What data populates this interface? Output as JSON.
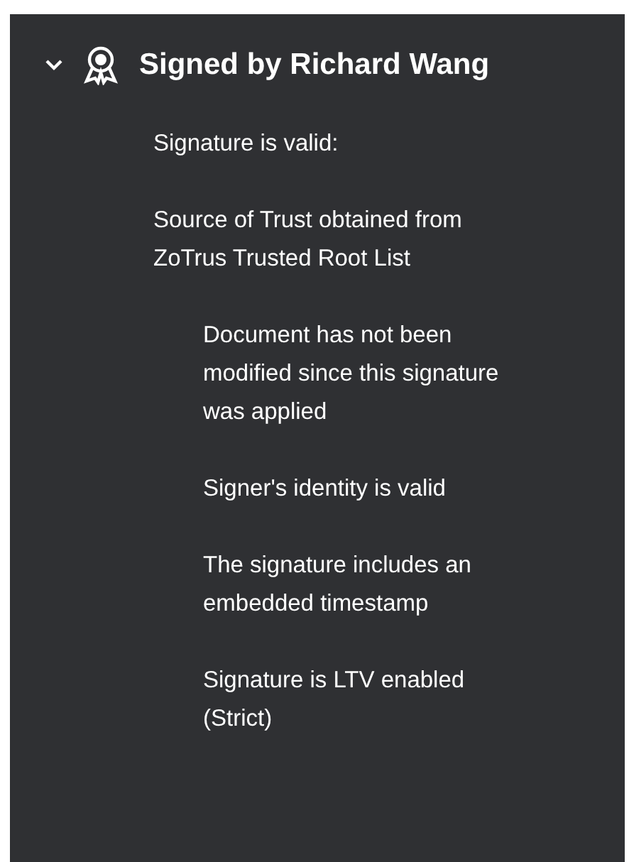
{
  "signature": {
    "title": "Signed by Richard Wang",
    "expanded": true,
    "children": [
      {
        "lines": [
          "Signature is valid:"
        ]
      },
      {
        "lines": [
          "Source of Trust obtained from",
          "ZoTrus Trusted Root List"
        ],
        "children": [
          {
            "lines": [
              "Document has not been",
              "modified since this signature",
              "was applied"
            ]
          },
          {
            "lines": [
              "Signer's identity is valid"
            ]
          },
          {
            "lines": [
              "The signature includes an",
              "embedded timestamp"
            ]
          },
          {
            "lines": [
              "Signature is LTV enabled",
              "(Strict)"
            ]
          }
        ]
      }
    ]
  }
}
